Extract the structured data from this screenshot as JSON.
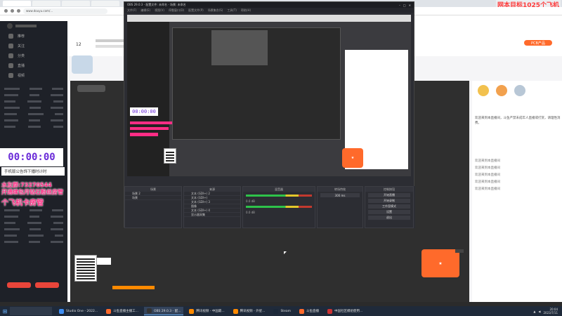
{
  "browser": {
    "tabs": [
      "",
      "",
      "",
      ""
    ],
    "address": "www.douyu.com/..."
  },
  "banner_goal": "网本目标1025个飞机",
  "timer": {
    "value": "00:00:00",
    "subtitle": "手机版公告饰下播时计时"
  },
  "overlay_lines": {
    "qq": "水友群:73270544",
    "promo": "开通续包月钻石粉丝房管",
    "plane": "个飞机卡房管"
  },
  "obs": {
    "title": "OBS 29.0.3 - 配置文件: 未命名 - 场景: 未命名",
    "menu": [
      "文件(F)",
      "编辑(E)",
      "视图(V)",
      "停靠窗口(D)",
      "配置文件(P)",
      "场景集合(S)",
      "工具(T)",
      "帮助(H)"
    ],
    "docks": {
      "scenes_header": "场景",
      "sources_header": "来源",
      "mixer_header": "混音器",
      "transitions_header": "转场特效",
      "controls_header": "控制按钮"
    },
    "scenes": [
      "场景 2",
      "场景"
    ],
    "sources": [
      "文本 (GDI+) 2",
      "文本 (GDI+)",
      "文本 (GDI+) 3",
      "图像",
      "文本 (GDI+) 4",
      "显示器采集"
    ],
    "controls": [
      "开始直播",
      "开始录制",
      "工作室模式",
      "设置",
      "退出"
    ],
    "mixer_vals": [
      "0.0 dB",
      "0.0 dB"
    ],
    "transition_duration": "300 ms"
  },
  "taskbar": {
    "items": [
      "Studio One - 2022...",
      "斗鱼直播主播工...",
      "OBS 29.0.3 - 配...",
      "腾讯视频 - 中国最...",
      "腾讯视频 - 外星...",
      "Steam",
      "斗鱼直播",
      "中国社区模组使用..."
    ],
    "icon_colors": [
      "#3f8ef2",
      "#ff6a2b",
      "#333333",
      "#ff8a00",
      "#ff8a00",
      "#1b2838",
      "#ff6a2b",
      "#cc3333"
    ],
    "clock_time": "20:04",
    "clock_date": "2023/7/11"
  },
  "site": {
    "follow_count": "12",
    "pcb_btn": "PCB产品",
    "sidebar_items": [
      "推荐",
      "关注",
      "分类",
      "直播",
      "视频"
    ],
    "chat_tip": "欢迎来到本直播间，斗鱼严禁未成年人直播或打赏，请理性消费。",
    "chat_lines": [
      "欢迎来到本直播间",
      "欢迎来到本直播间",
      "欢迎来到本直播间",
      "欢迎来到本直播间",
      "欢迎来到本直播间"
    ]
  }
}
